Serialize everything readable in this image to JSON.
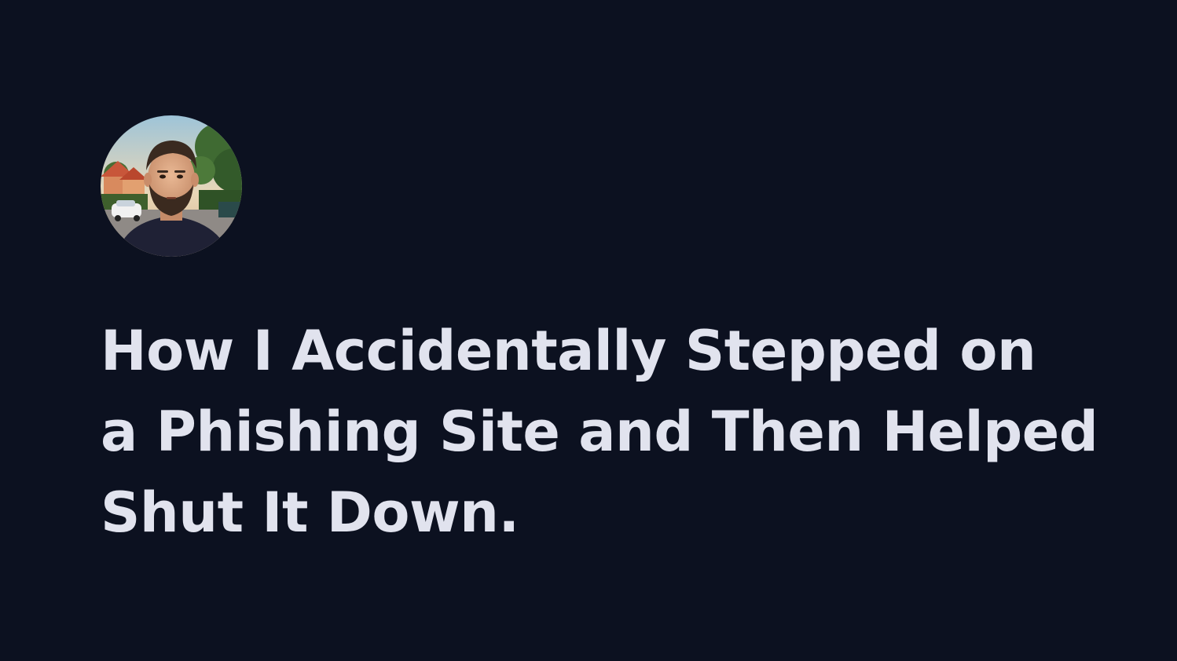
{
  "author": {
    "avatar_icon": "author-avatar-photo"
  },
  "post": {
    "title_lines": [
      "How I Accidentally Stepped on",
      "a Phishing Site and Then Helped",
      "Shut It Down."
    ]
  },
  "colors": {
    "background": "#0c1120",
    "title_text": "#e1e3ee"
  }
}
